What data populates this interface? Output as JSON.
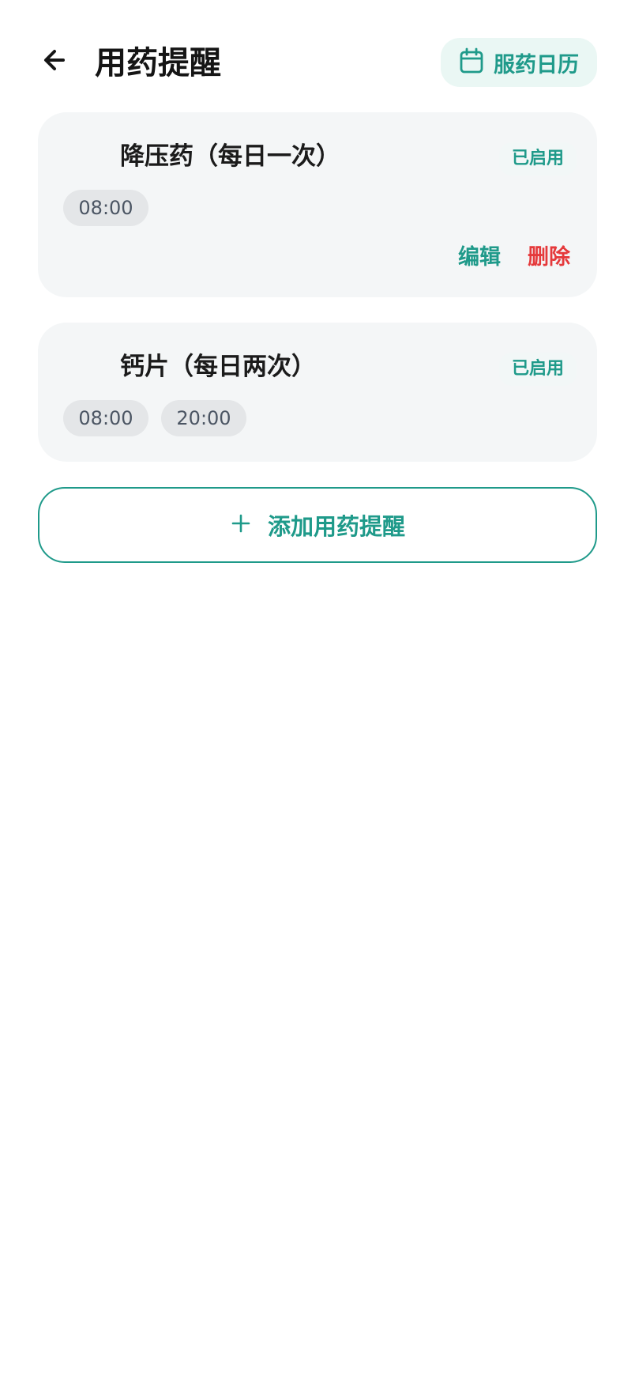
{
  "header": {
    "title": "用药提醒",
    "back_icon": "arrow-left-icon",
    "calendar_button_label": "服药日历",
    "calendar_icon": "calendar-icon"
  },
  "reminders": [
    {
      "name": "降压药（每日一次）",
      "status": "已启用",
      "times": [
        "08:00"
      ],
      "edit_label": "编辑",
      "delete_label": "删除"
    },
    {
      "name": "钙片（每日两次）",
      "status": "已启用",
      "times": [
        "08:00",
        "20:00"
      ]
    }
  ],
  "add_button": {
    "label": "添加用药提醒",
    "icon": "plus-icon"
  },
  "colors": {
    "accent": "#1f9a8a",
    "danger": "#e5393b",
    "card_bg": "#f4f6f7",
    "chip_bg": "#e4e6e8"
  }
}
